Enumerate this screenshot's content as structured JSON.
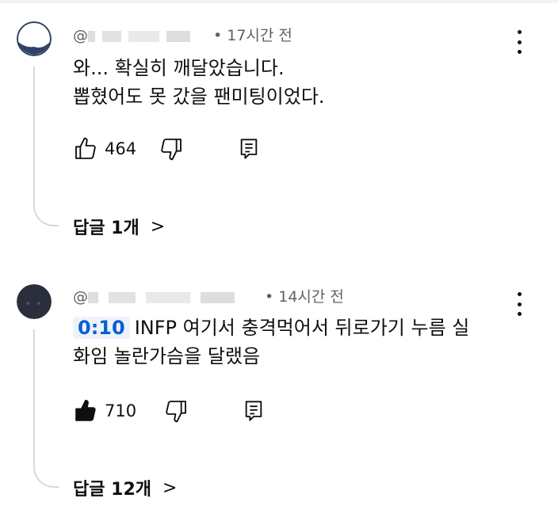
{
  "comments": [
    {
      "handle": "@",
      "time": "• 17시간 전",
      "lines": [
        "와... 확실히 깨달았습니다.",
        "뽑혔어도 못 갔을 팬미팅이었다."
      ],
      "timestamp_link": "",
      "likes": "464",
      "liked": false,
      "replies_label": "답글 1개",
      "reply_chevron": ">"
    },
    {
      "handle": "@",
      "time": "• 14시간 전",
      "timestamp_link": "0:10",
      "lines": [
        "INFP 여기서 충격먹어서 뒤로가기 누름 실",
        "화임 놀란가슴을 달랬음"
      ],
      "likes": "710",
      "liked": true,
      "replies_label": "답글 12개",
      "reply_chevron": ">"
    }
  ],
  "icons": {
    "like": "thumbs-up-icon",
    "dislike": "thumbs-down-icon",
    "reply": "reply-icon",
    "more": "more-vert-icon"
  },
  "colors": {
    "timestamp_link": "#065fd4",
    "meta": "#606060",
    "thread_line": "#d9d9d9"
  }
}
